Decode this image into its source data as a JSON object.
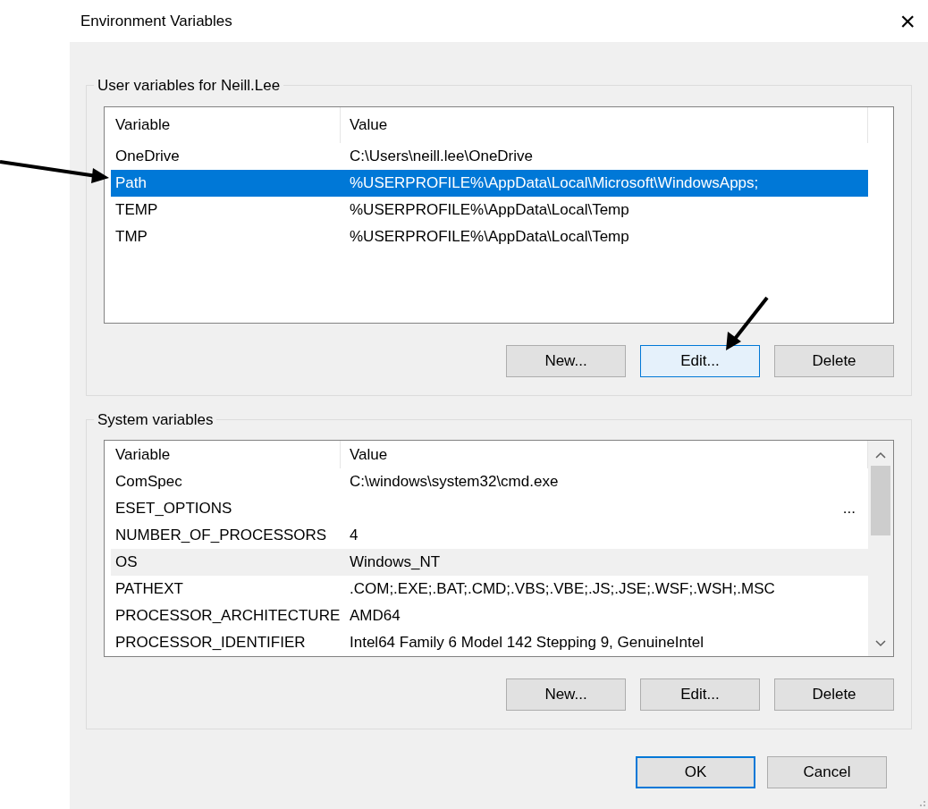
{
  "window": {
    "title": "Environment Variables",
    "close": "×"
  },
  "user_group": {
    "label": "User variables for Neill.Lee",
    "columns": [
      "Variable",
      "Value"
    ],
    "rows": [
      {
        "variable": "OneDrive",
        "value": "C:\\Users\\neill.lee\\OneDrive",
        "selected": false
      },
      {
        "variable": "Path",
        "value": "%USERPROFILE%\\AppData\\Local\\Microsoft\\WindowsApps;",
        "selected": true
      },
      {
        "variable": "TEMP",
        "value": "%USERPROFILE%\\AppData\\Local\\Temp",
        "selected": false
      },
      {
        "variable": "TMP",
        "value": "%USERPROFILE%\\AppData\\Local\\Temp",
        "selected": false
      }
    ],
    "buttons": [
      {
        "label": "New...",
        "hovered": false
      },
      {
        "label": "Edit...",
        "hovered": true
      },
      {
        "label": "Delete",
        "hovered": false
      }
    ]
  },
  "system_group": {
    "label": "System variables",
    "columns": [
      "Variable",
      "Value"
    ],
    "rows": [
      {
        "variable": "ComSpec",
        "value": "C:\\windows\\system32\\cmd.exe",
        "selected": false,
        "hovered": false
      },
      {
        "variable": "ESET_OPTIONS",
        "value": "...",
        "selected": false,
        "hovered": false
      },
      {
        "variable": "NUMBER_OF_PROCESSORS",
        "value": "4",
        "selected": false,
        "hovered": false
      },
      {
        "variable": "OS",
        "value": "Windows_NT",
        "selected": false,
        "hovered": true
      },
      {
        "variable": "PATHEXT",
        "value": ".COM;.EXE;.BAT;.CMD;.VBS;.VBE;.JS;.JSE;.WSF;.WSH;.MSC",
        "selected": false,
        "hovered": false
      },
      {
        "variable": "PROCESSOR_ARCHITECTURE",
        "value": "AMD64",
        "selected": false,
        "hovered": false
      },
      {
        "variable": "PROCESSOR_IDENTIFIER",
        "value": "Intel64 Family 6 Model 142 Stepping 9, GenuineIntel",
        "selected": false,
        "hovered": false
      }
    ],
    "buttons": [
      {
        "label": "New...",
        "hovered": false
      },
      {
        "label": "Edit...",
        "hovered": false
      },
      {
        "label": "Delete",
        "hovered": false
      }
    ]
  },
  "footer_buttons": [
    {
      "label": "OK",
      "default": true
    },
    {
      "label": "Cancel",
      "default": false
    }
  ]
}
